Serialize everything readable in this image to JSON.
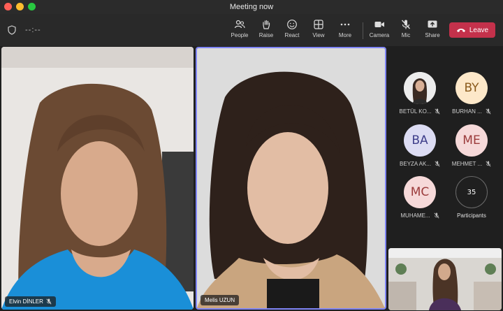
{
  "window": {
    "title": "Meeting now"
  },
  "toolbar": {
    "timer": "--:--",
    "buttons": {
      "people": "People",
      "raise": "Raise",
      "react": "React",
      "view": "View",
      "more": "More",
      "camera": "Camera",
      "mic": "Mic",
      "share": "Share"
    },
    "leave": "Leave"
  },
  "stage": {
    "left": {
      "name": "Elvin DİNLER"
    },
    "center": {
      "name": "Melis UZUN"
    }
  },
  "gallery": {
    "items": [
      {
        "initials": "",
        "name": "BETÜL KO...",
        "bg": "#f3f3f3",
        "fg": "#333333",
        "photo": true
      },
      {
        "initials": "BY",
        "name": "BURHAN ...",
        "bg": "#fde8c9",
        "fg": "#8a5a1c"
      },
      {
        "initials": "BA",
        "name": "BEYZA AK...",
        "bg": "#dcdcf3",
        "fg": "#3e3e8a"
      },
      {
        "initials": "ME",
        "name": "MEHMET ...",
        "bg": "#f6d9d9",
        "fg": "#9b3b3b"
      },
      {
        "initials": "MC",
        "name": "MUHAME...",
        "bg": "#f6d9d9",
        "fg": "#9b3b3b"
      }
    ],
    "participants": {
      "count": "35",
      "label": "Participants"
    }
  },
  "colors": {
    "accent": "#7f85f5",
    "leave": "#c4314b"
  }
}
